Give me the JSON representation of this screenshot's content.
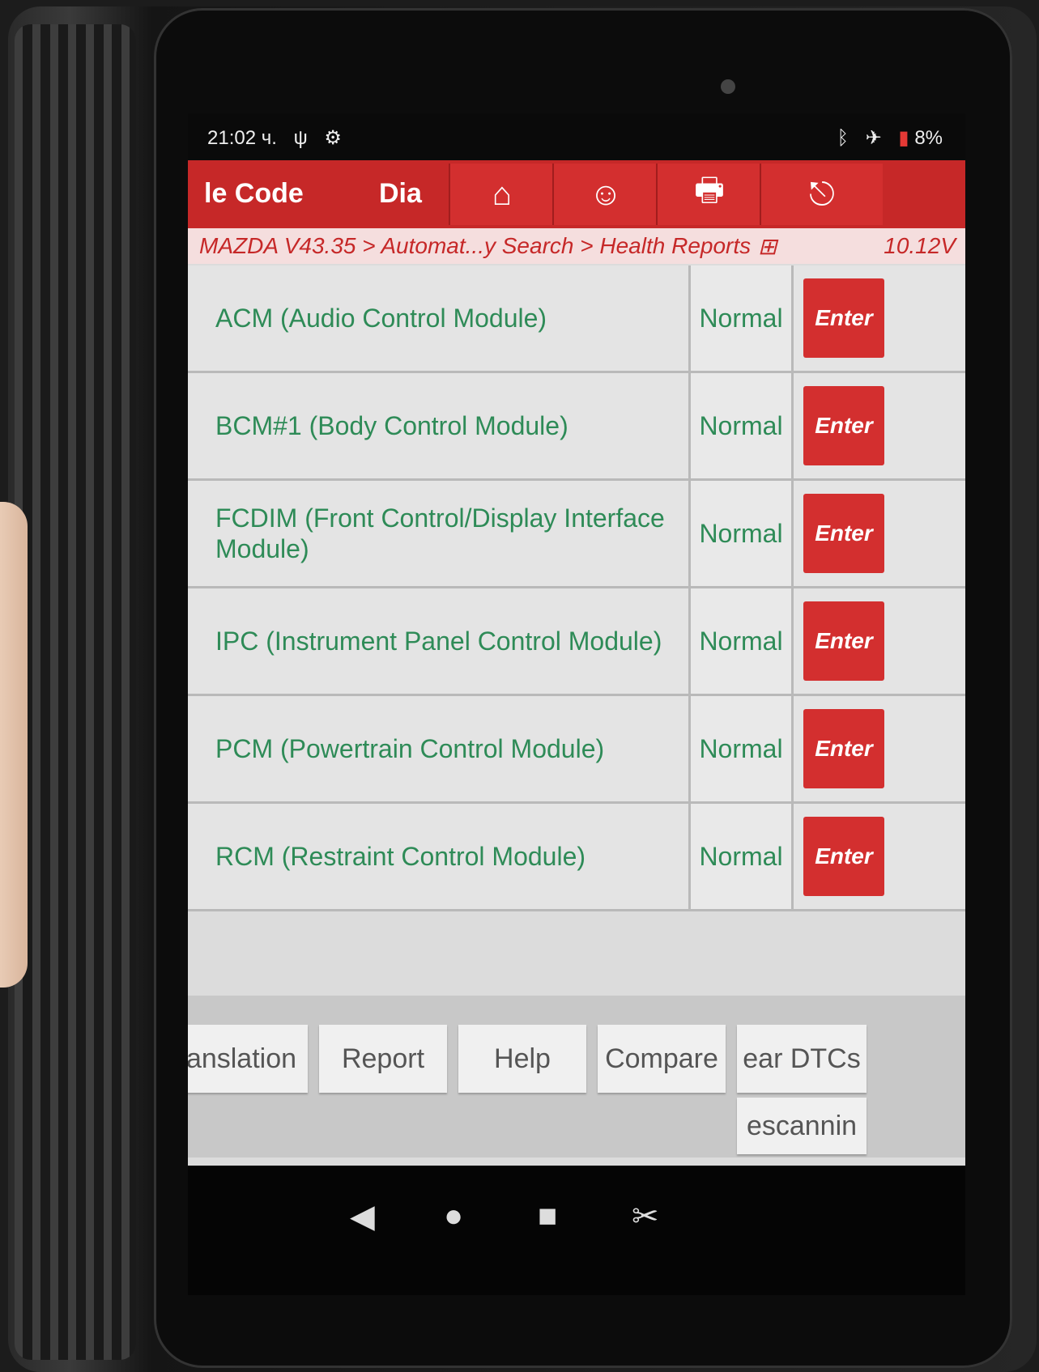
{
  "status_bar": {
    "time": "21:02 ч.",
    "left_icons": [
      "usb-icon",
      "settings-icon"
    ],
    "right_icons": [
      "bluetooth-icon",
      "airplane-icon",
      "battery-icon"
    ],
    "battery": "8%"
  },
  "top_bar": {
    "tab1_label": "le Code",
    "tab2_label": "Dia",
    "buttons": [
      "home-icon",
      "user-icon",
      "print-icon",
      "exit-icon"
    ],
    "glyphs": {
      "home": "⌂",
      "user": "☺",
      "print": "🖶",
      "exit": "⎋"
    }
  },
  "breadcrumb": {
    "path": "MAZDA V43.35 > Automat...y Search > Health Reports",
    "voltage": "10.12V"
  },
  "modules": [
    {
      "name": "ACM (Audio Control Module)",
      "status": "Normal",
      "action": "Enter"
    },
    {
      "name": "BCM#1 (Body Control Module)",
      "status": "Normal",
      "action": "Enter"
    },
    {
      "name": "FCDIM (Front Control/Display Interface Module)",
      "status": "Normal",
      "action": "Enter"
    },
    {
      "name": "IPC (Instrument Panel Control Module)",
      "status": "Normal",
      "action": "Enter"
    },
    {
      "name": "PCM (Powertrain Control Module)",
      "status": "Normal",
      "action": "Enter"
    },
    {
      "name": "RCM (Restraint Control Module)",
      "status": "Normal",
      "action": "Enter"
    }
  ],
  "bottom_buttons": {
    "translation": "anslation",
    "report": "Report",
    "help": "Help",
    "compare": "Compare",
    "clear_dtcs": "ear DTCs",
    "rescanning": "escannin"
  },
  "colors": {
    "accent": "#c62828",
    "text_green": "#2e8b57"
  }
}
